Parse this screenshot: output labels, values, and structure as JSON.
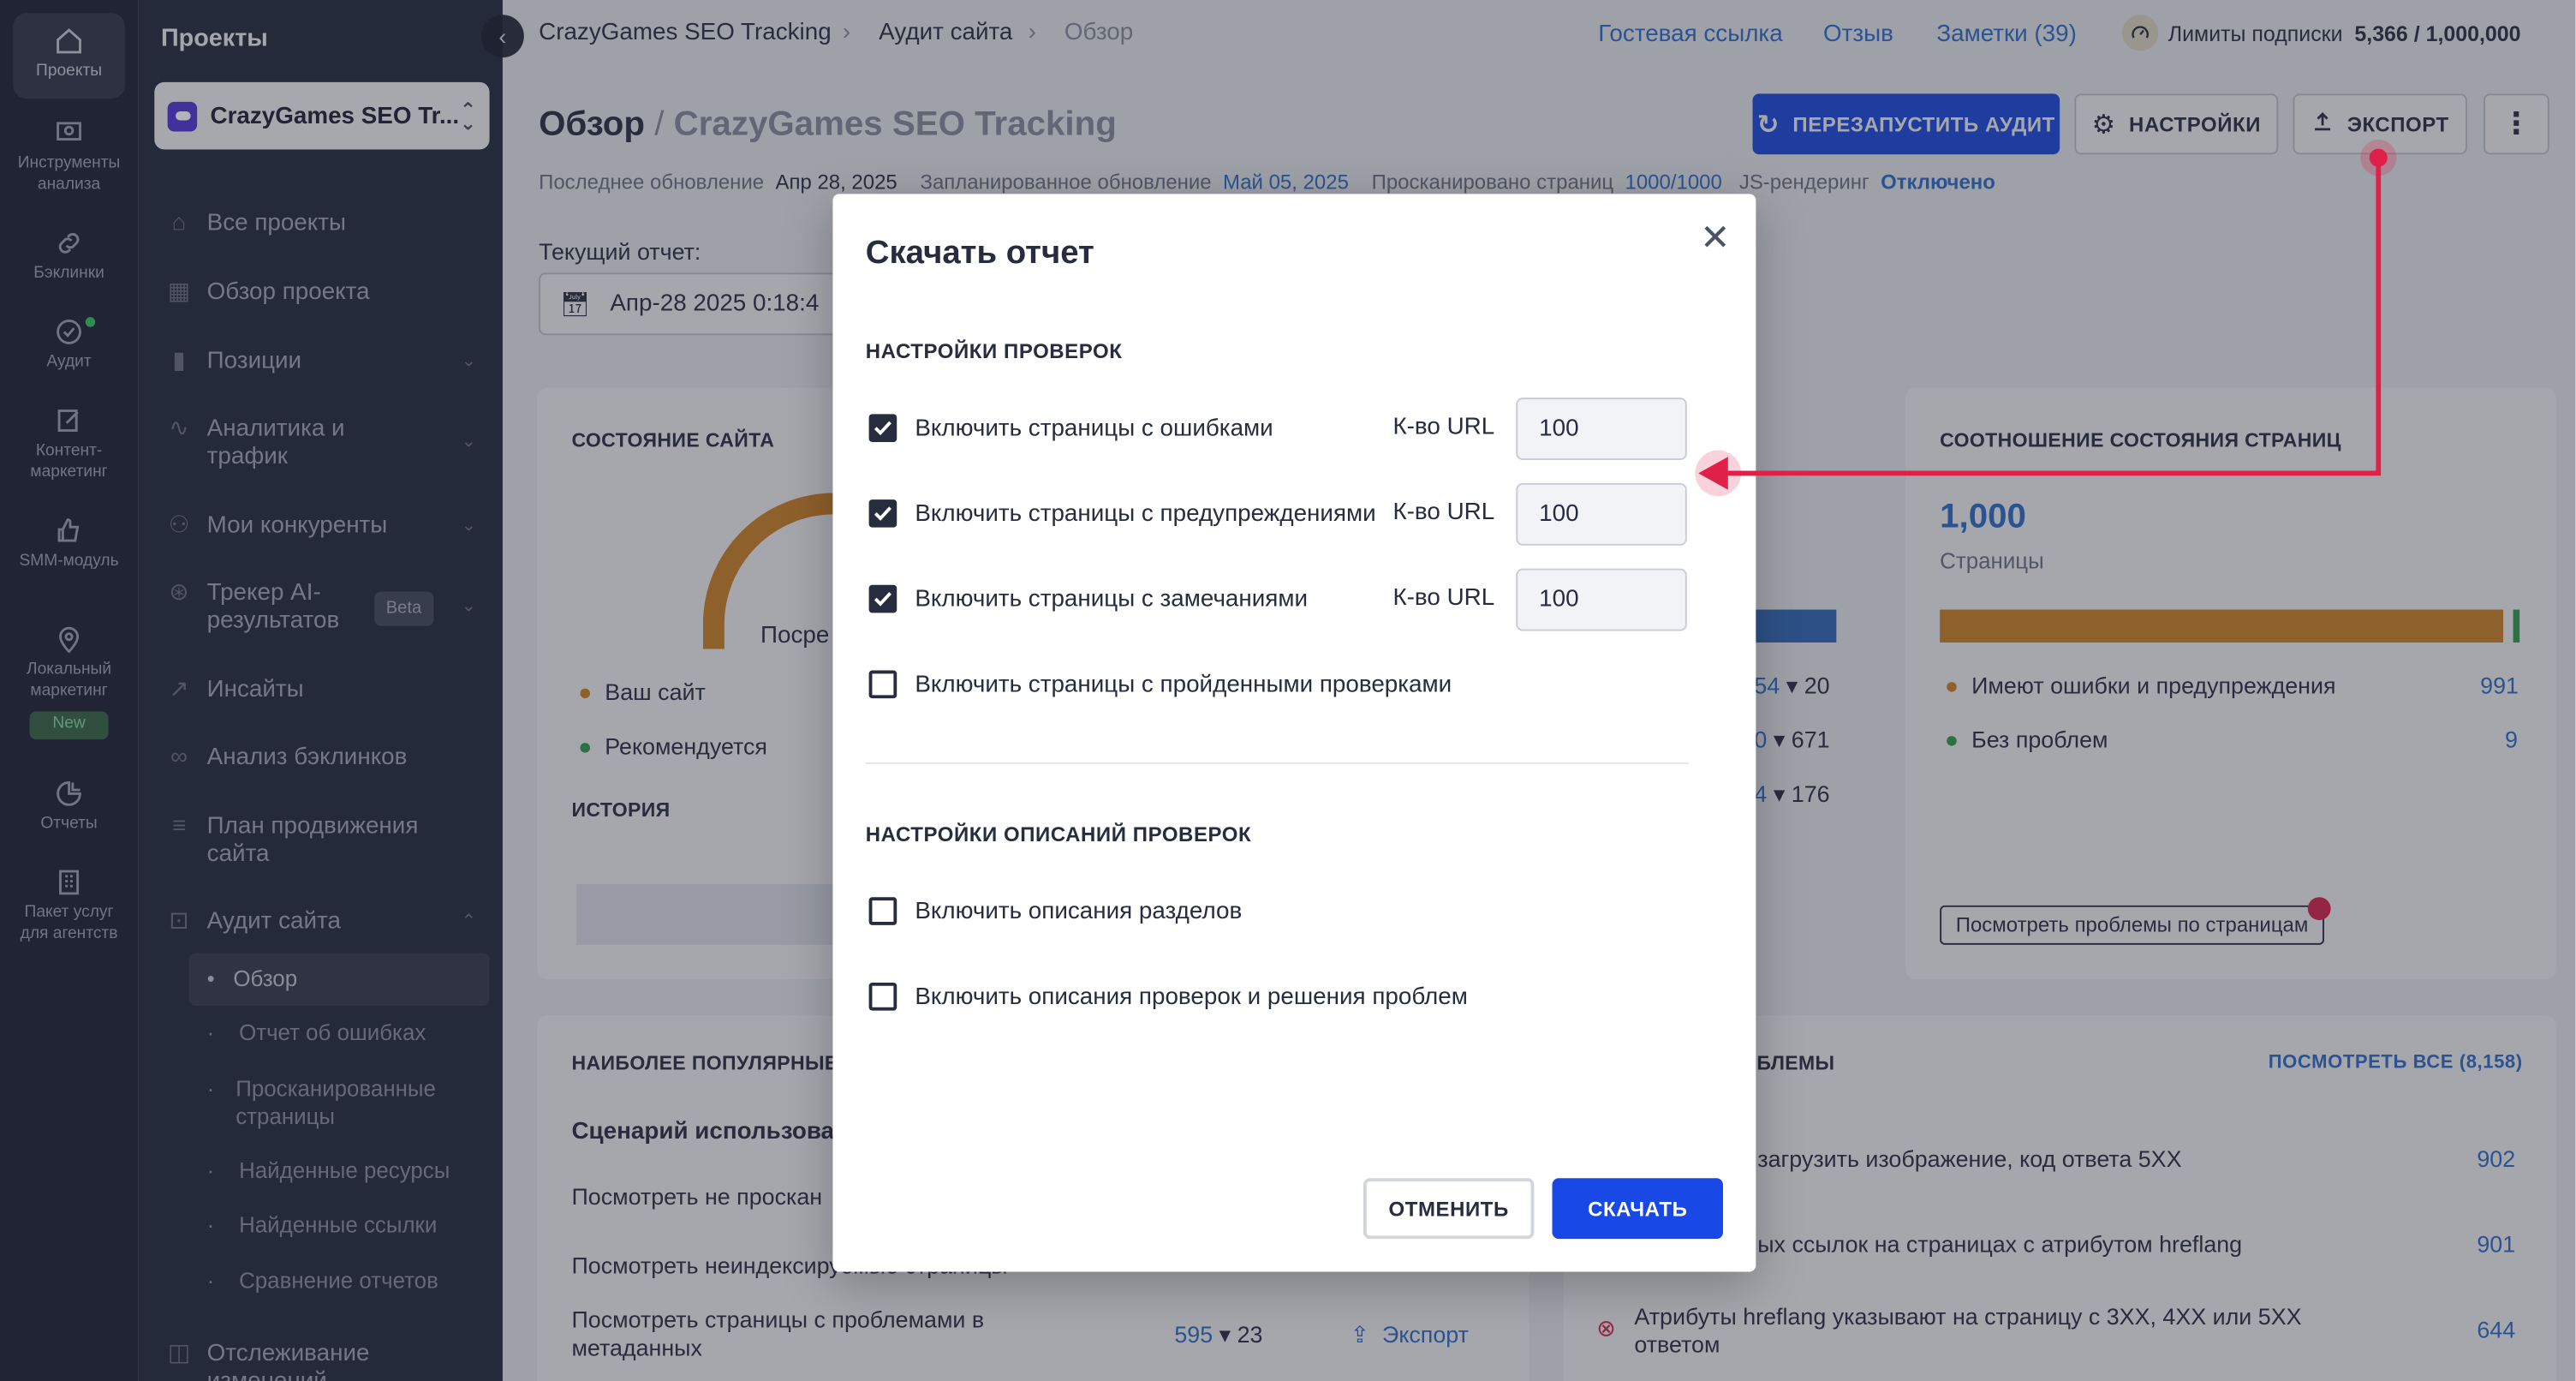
{
  "rail": [
    {
      "label": "Проекты",
      "icon": "home-icon"
    },
    {
      "label": "Инструменты анализа",
      "icon": "monitor-icon"
    },
    {
      "label": "Бэклинки",
      "icon": "link-icon"
    },
    {
      "label": "Аудит",
      "icon": "check-circle-icon"
    },
    {
      "label": "Контент-маркетинг",
      "icon": "edit-icon"
    },
    {
      "label": "SMM-модуль",
      "icon": "thumbs-up-icon"
    },
    {
      "label": "Локальный маркетинг",
      "icon": "map-pin-icon",
      "badge": "New"
    },
    {
      "label": "Отчеты",
      "icon": "pie-icon"
    },
    {
      "label": "Пакет услуг для агентств",
      "icon": "building-icon"
    }
  ],
  "sidebar": {
    "title": "Проекты",
    "project": "CrazyGames SEO Tr...",
    "items": [
      "Все проекты",
      "Обзор проекта",
      "Позиции",
      "Аналитика и трафик",
      "Мои конкуренты",
      "Трекер AI-результатов",
      "Инсайты",
      "Анализ бэклинков",
      "План продвижения сайта",
      "Аудит сайта",
      "Отслеживание изменений"
    ],
    "beta": "Beta",
    "subitems": [
      "Обзор",
      "Отчет об ошибках",
      "Просканированные страницы",
      "Найденные ресурсы",
      "Найденные ссылки",
      "Сравнение отчетов"
    ]
  },
  "breadcrumb": [
    "CrazyGames SEO Tracking",
    "Аудит сайта",
    "Обзор"
  ],
  "toplinks": {
    "guest": "Гостевая ссылка",
    "feedback": "Отзыв",
    "notes": "Заметки (39)",
    "limits_label": "Лимиты подписки",
    "limits_value": "5,366 / 1,000,000"
  },
  "page": {
    "title": "Обзор",
    "title_sep": "/",
    "title_project": "CrazyGames SEO Tracking",
    "last_update_label": "Последнее обновление",
    "last_update": "Апр 28, 2025",
    "planned_label": "Запланированное обновление",
    "planned": "Май 05, 2025",
    "crawled_label": "Просканировано страниц",
    "crawled": "1000/1000",
    "js_label": "JS-рендеринг",
    "js": "Отключено",
    "current_report_label": "Текущий отчет:",
    "current_report": "Апр-28 2025 0:18:4"
  },
  "buttons": {
    "restart": "ПЕРЕЗАПУСТИТЬ АУДИТ",
    "settings": "НАСТРОЙКИ",
    "export": "ЭКСПОРТ"
  },
  "cards": {
    "site_state": "СОСТОЯНИЕ САЙТА",
    "your_site": "Ваш сайт",
    "recommended": "Рекомендуется",
    "history": "ИСТОРИЯ",
    "gauge_label": "Посре",
    "mid_values": [
      {
        "a": "54",
        "b": "20"
      },
      {
        "a": "0",
        "b": "671"
      },
      {
        "a": "4",
        "b": "176"
      }
    ],
    "ratio_title": "СООТНОШЕНИЕ СОСТОЯНИЯ СТРАНИЦ",
    "ratio_value": "1,000",
    "ratio_unit": "Страницы",
    "ratio_items": [
      {
        "label": "Имеют ошибки и предупреждения",
        "value": "991"
      },
      {
        "label": "Без проблем",
        "value": "9"
      }
    ],
    "view_issues": "Посмотреть проблемы по страницам",
    "popular_title": "НАИБОЛЕЕ ПОПУЛЯРНЫЕ",
    "scenario": "Сценарий использова",
    "popular_rows": [
      "Посмотреть не проскан",
      "Посмотреть неиндексируемые страницы",
      "Посмотреть страницы с проблемами в метаданных"
    ],
    "popular_nums": {
      "a": "595",
      "b": "23"
    },
    "export_link": "Экспорт",
    "issues_title": "ОБЛЕМЫ",
    "view_all": "ПОСМОТРЕТЬ ВСЕ (8,158)",
    "issues": [
      {
        "label": "загрузить изображение, код ответа 5XX",
        "value": "902"
      },
      {
        "label": "ых ссылок на страницах с атрибутом hreflang",
        "value": "901"
      },
      {
        "label": "Атрибуты hreflang указывают на страницу с 3XX, 4XX или 5XX ответом",
        "value": "644"
      }
    ]
  },
  "modal": {
    "title": "Скачать отчет",
    "section1": "НАСТРОЙКИ ПРОВЕРОК",
    "checks": [
      {
        "label": "Включить страницы с ошибками",
        "checked": true,
        "url_label": "К-во URL",
        "value": "100"
      },
      {
        "label": "Включить страницы с предупреждениями",
        "checked": true,
        "url_label": "К-во URL",
        "value": "100"
      },
      {
        "label": "Включить страницы с замечаниями",
        "checked": true,
        "url_label": "К-во URL",
        "value": "100"
      },
      {
        "label": "Включить страницы с пройденными проверками",
        "checked": false
      }
    ],
    "section2": "НАСТРОЙКИ ОПИСАНИЙ ПРОВЕРОК",
    "desc_checks": [
      {
        "label": "Включить описания разделов",
        "checked": false
      },
      {
        "label": "Включить описания проверок и решения проблем",
        "checked": false
      }
    ],
    "cancel": "ОТМЕНИТЬ",
    "download": "СКАЧАТЬ"
  },
  "colors": {
    "accent": "#1849e6",
    "annotation": "#e1204a",
    "orange": "#d6861f",
    "green": "#2da04b"
  }
}
